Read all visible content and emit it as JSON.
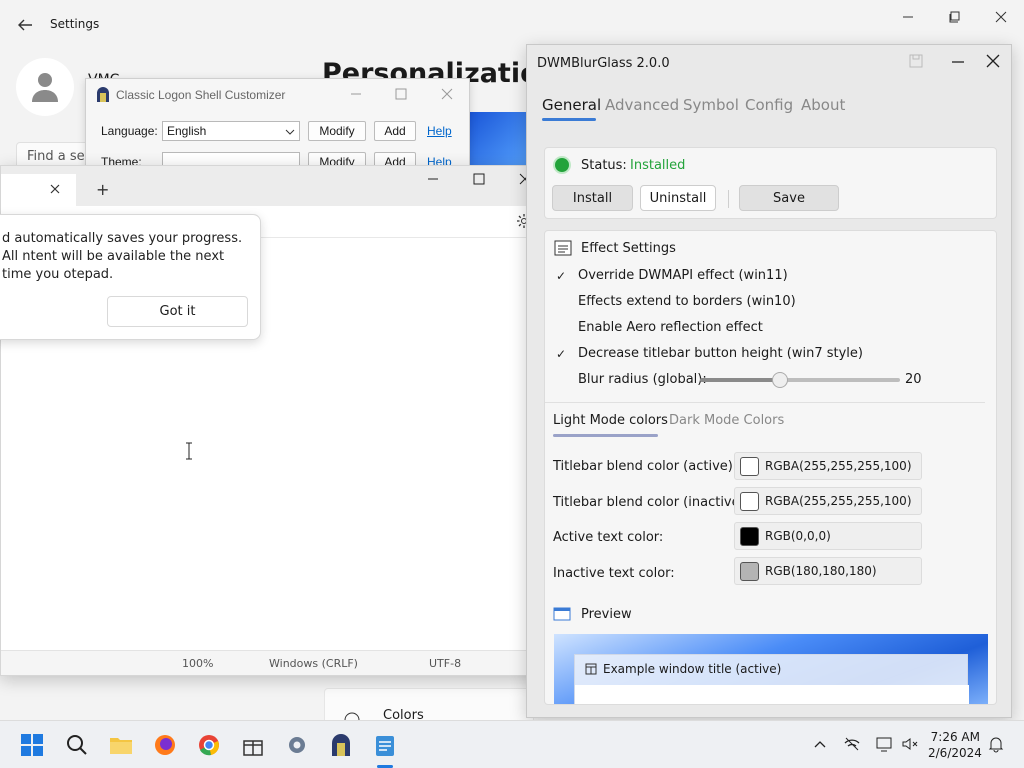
{
  "settings": {
    "title": "Settings",
    "user": "VMC",
    "find_placeholder": "Find a set",
    "heading": "Personalization",
    "colors_label": "Colors"
  },
  "classic": {
    "title": "Classic Logon Shell Customizer",
    "language_label": "Language:",
    "language_value": "English",
    "theme_label": "Theme:",
    "modify": "Modify",
    "add": "Add",
    "help": "Help"
  },
  "notepad": {
    "tip_text": "d automatically saves your progress. All ntent will be available the next time you otepad.",
    "got_it": "Got it",
    "status": {
      "zoom": "100%",
      "line_ending": "Windows (CRLF)",
      "encoding": "UTF-8"
    },
    "new_tab": "+"
  },
  "dwm": {
    "title": "DWMBlurGlass 2.0.0",
    "tabs": [
      "General",
      "Advanced",
      "Symbol",
      "Config",
      "About"
    ],
    "status_label": "Status:",
    "status_value": "Installed",
    "install": "Install",
    "uninstall": "Uninstall",
    "save": "Save",
    "effect_settings": "Effect Settings",
    "options": [
      {
        "label": "Override DWMAPI effect (win11)",
        "checked": true
      },
      {
        "label": "Effects extend to borders (win10)",
        "checked": false
      },
      {
        "label": "Enable Aero reflection effect",
        "checked": false
      },
      {
        "label": "Decrease titlebar button height (win7 style)",
        "checked": true
      },
      {
        "label": "Blur radius (global):",
        "checked": false
      }
    ],
    "blur_radius": "20",
    "blur_fraction": 0.4,
    "color_tabs": [
      "Light Mode colors",
      "Dark Mode Colors"
    ],
    "colors": [
      {
        "label": "Titlebar blend color (active):",
        "value": "RGBA(255,255,255,100)",
        "swatch": "#ffffff"
      },
      {
        "label": "Titlebar blend color (inactive):",
        "value": "RGBA(255,255,255,100)",
        "swatch": "#ffffff"
      },
      {
        "label": "Active text color:",
        "value": "RGB(0,0,0)",
        "swatch": "#000000"
      },
      {
        "label": "Inactive text color:",
        "value": "RGB(180,180,180)",
        "swatch": "#b4b4b4"
      }
    ],
    "preview_label": "Preview",
    "example_title": "Example window title (active)",
    "accent": "#3a7bd5",
    "status_color": "#22a33a"
  },
  "taskbar": {
    "time": "7:26 AM",
    "date": "2/6/2024"
  }
}
